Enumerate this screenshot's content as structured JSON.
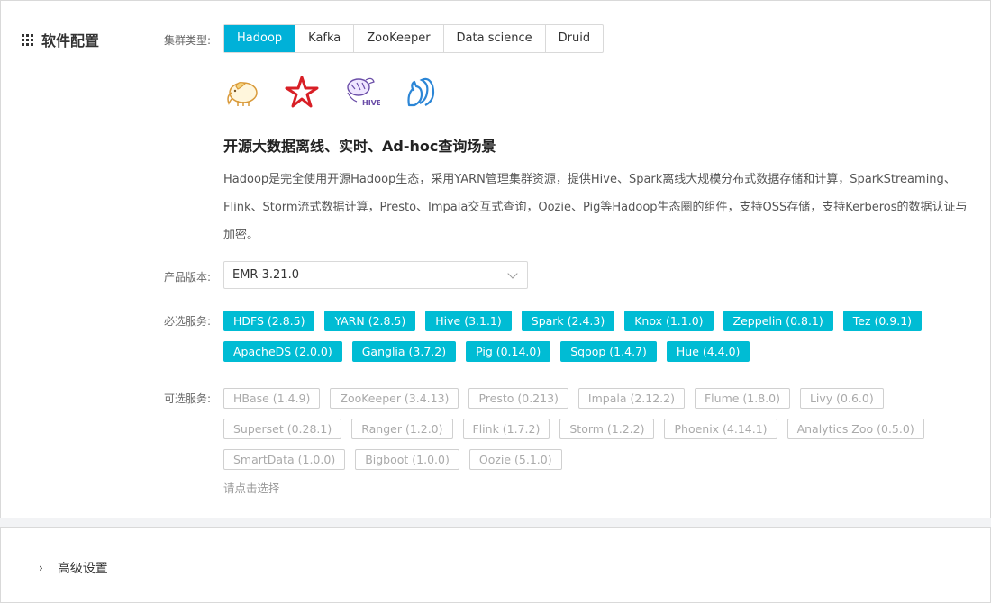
{
  "section": {
    "title": "软件配置",
    "icon": "grid-icon"
  },
  "cluster_type": {
    "label": "集群类型:",
    "tabs": [
      {
        "label": "Hadoop",
        "active": true
      },
      {
        "label": "Kafka",
        "active": false
      },
      {
        "label": "ZooKeeper",
        "active": false
      },
      {
        "label": "Data science",
        "active": false
      },
      {
        "label": "Druid",
        "active": false
      }
    ]
  },
  "logos": [
    "hadoop-elephant-icon",
    "spark-star-icon",
    "hive-bee-icon",
    "squirrel-icon"
  ],
  "scene": {
    "title": "开源大数据离线、实时、Ad-hoc查询场景",
    "description": "Hadoop是完全使用开源Hadoop生态，采用YARN管理集群资源，提供Hive、Spark离线大规模分布式数据存储和计算，SparkStreaming、Flink、Storm流式数据计算，Presto、Impala交互式查询，Oozie、Pig等Hadoop生态圈的组件，支持OSS存储，支持Kerberos的数据认证与加密。"
  },
  "version": {
    "label": "产品版本:",
    "value": "EMR-3.21.0"
  },
  "required_services": {
    "label": "必选服务:",
    "items": [
      "HDFS (2.8.5)",
      "YARN (2.8.5)",
      "Hive (3.1.1)",
      "Spark (2.4.3)",
      "Knox (1.1.0)",
      "Zeppelin (0.8.1)",
      "Tez (0.9.1)",
      "ApacheDS (2.0.0)",
      "Ganglia (3.7.2)",
      "Pig (0.14.0)",
      "Sqoop (1.4.7)",
      "Hue (4.4.0)"
    ]
  },
  "optional_services": {
    "label": "可选服务:",
    "items": [
      "HBase (1.4.9)",
      "ZooKeeper (3.4.13)",
      "Presto (0.213)",
      "Impala (2.12.2)",
      "Flume (1.8.0)",
      "Livy (0.6.0)",
      "Superset (0.28.1)",
      "Ranger (1.2.0)",
      "Flink (1.7.2)",
      "Storm (1.2.2)",
      "Phoenix (4.14.1)",
      "Analytics Zoo (0.5.0)",
      "SmartData (1.0.0)",
      "Bigboot (1.0.0)",
      "Oozie (5.1.0)"
    ],
    "hint": "请点击选择"
  },
  "advanced": {
    "label": "高级设置",
    "caret": "›"
  },
  "colors": {
    "accent": "#00b1d8",
    "tag_bg": "#00bcd4",
    "muted": "#aaaaaa"
  }
}
